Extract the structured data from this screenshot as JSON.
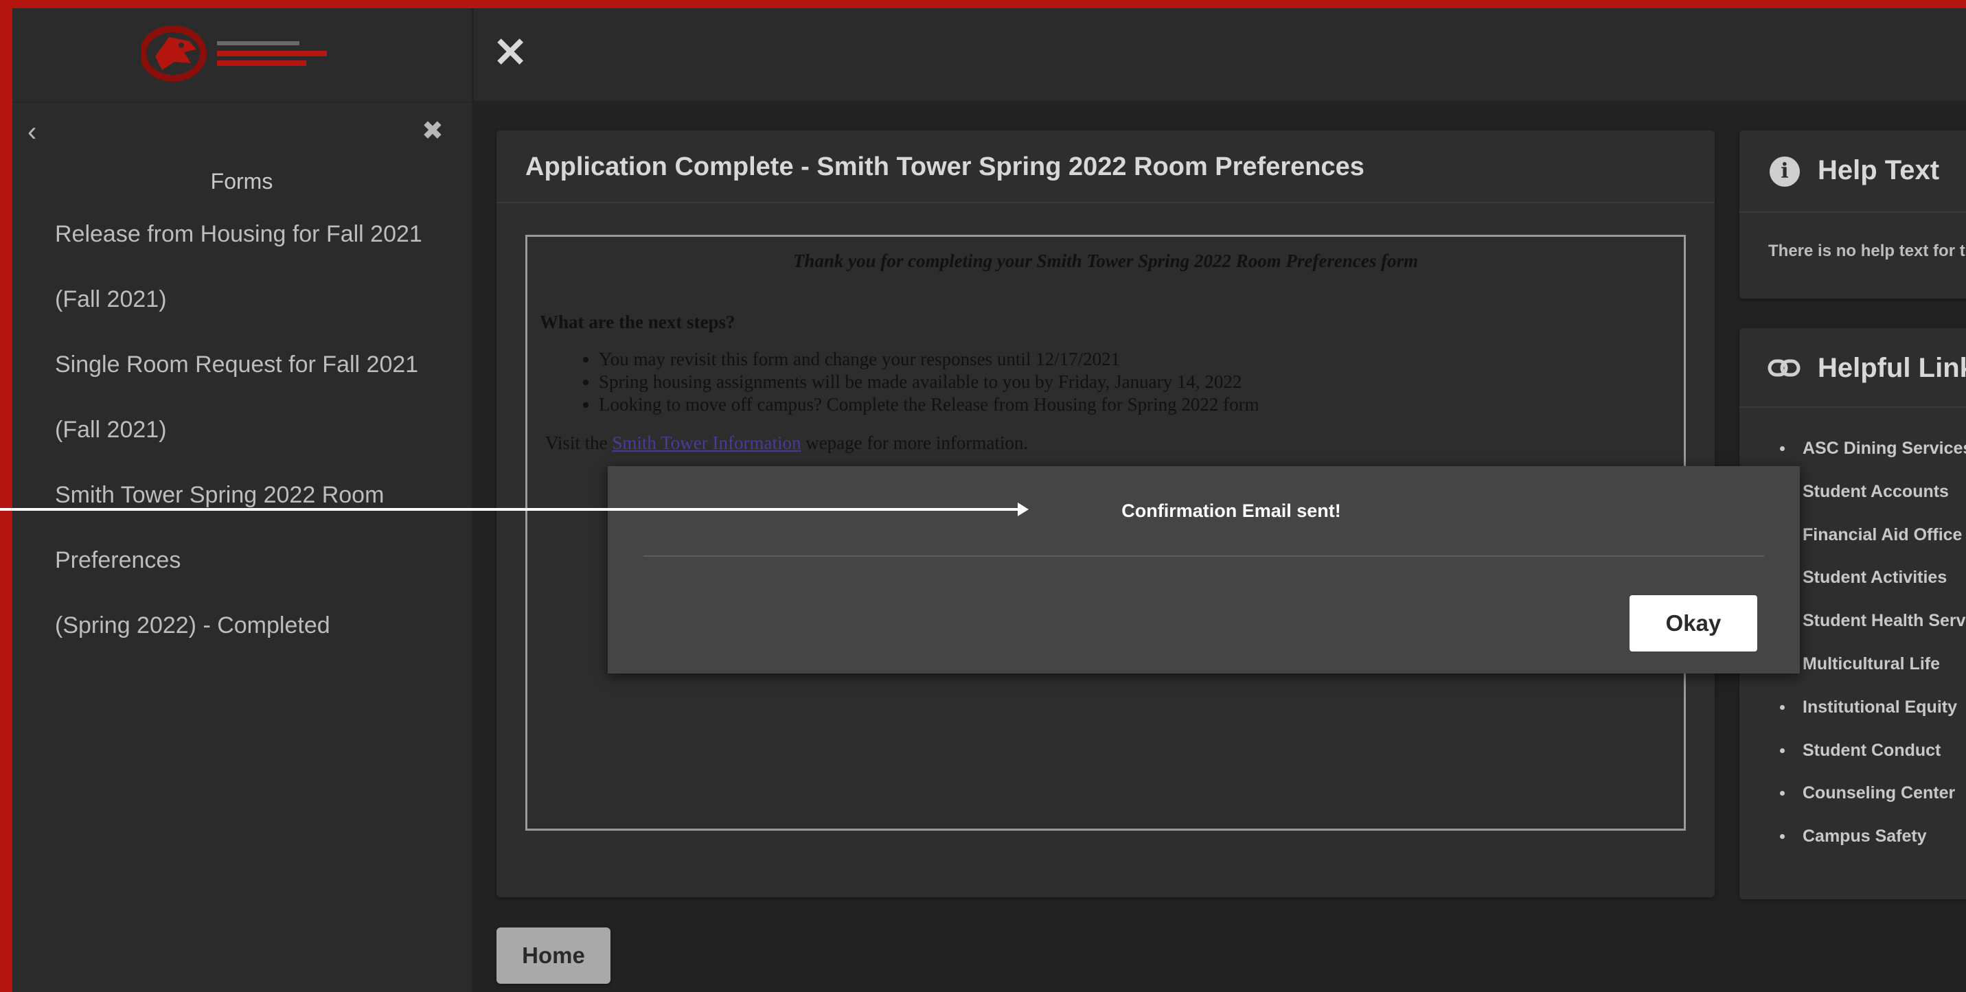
{
  "app": {
    "close_glyph": "✕"
  },
  "sidebar": {
    "logo_label": "logo",
    "back_glyph": "‹",
    "close_glyph": "✖",
    "forms_title": "Forms",
    "items": [
      {
        "label": "Release from Housing for Fall 2021"
      },
      {
        "label": "(Fall 2021)"
      },
      {
        "label": "Single Room Request for Fall 2021"
      },
      {
        "label": "(Fall 2021)"
      },
      {
        "label": "Smith Tower Spring 2022 Room"
      },
      {
        "label": "Preferences"
      },
      {
        "label": "(Spring 2022) - Completed"
      }
    ]
  },
  "main": {
    "title": "Application Complete - Smith Tower Spring 2022 Room Preferences",
    "thanks": "Thank you for completing your Smith Tower Spring 2022 Room Preferences form",
    "next_steps_heading": "What are the next steps?",
    "steps": [
      "You may revisit this form and change your responses until 12/17/2021",
      "Spring housing assignments will be made available to you by Friday, January 14, 2022",
      "Looking to move off campus? Complete the Release from Housing for Spring 2022 form"
    ],
    "visit_prefix": "Visit the",
    "visit_link": "Smith Tower Information",
    "visit_suffix": "wepage for more information."
  },
  "help": {
    "title": "Help Text",
    "body": "There is no help text for this"
  },
  "links": {
    "title": "Helpful Links",
    "items": [
      "ASC Dining Services",
      "Student Accounts",
      "Financial Aid Office",
      "Student Activities",
      "Student Health Services",
      "Multicultural Life",
      "Institutional Equity",
      "Student Conduct",
      "Counseling Center",
      "Campus Safety"
    ]
  },
  "home_button": "Home",
  "modal": {
    "message": "Confirmation Email sent!",
    "okay_label": "Okay"
  },
  "colors": {
    "accent_red": "#b4160f",
    "background": "#222222",
    "panel": "#2e2e2e"
  }
}
